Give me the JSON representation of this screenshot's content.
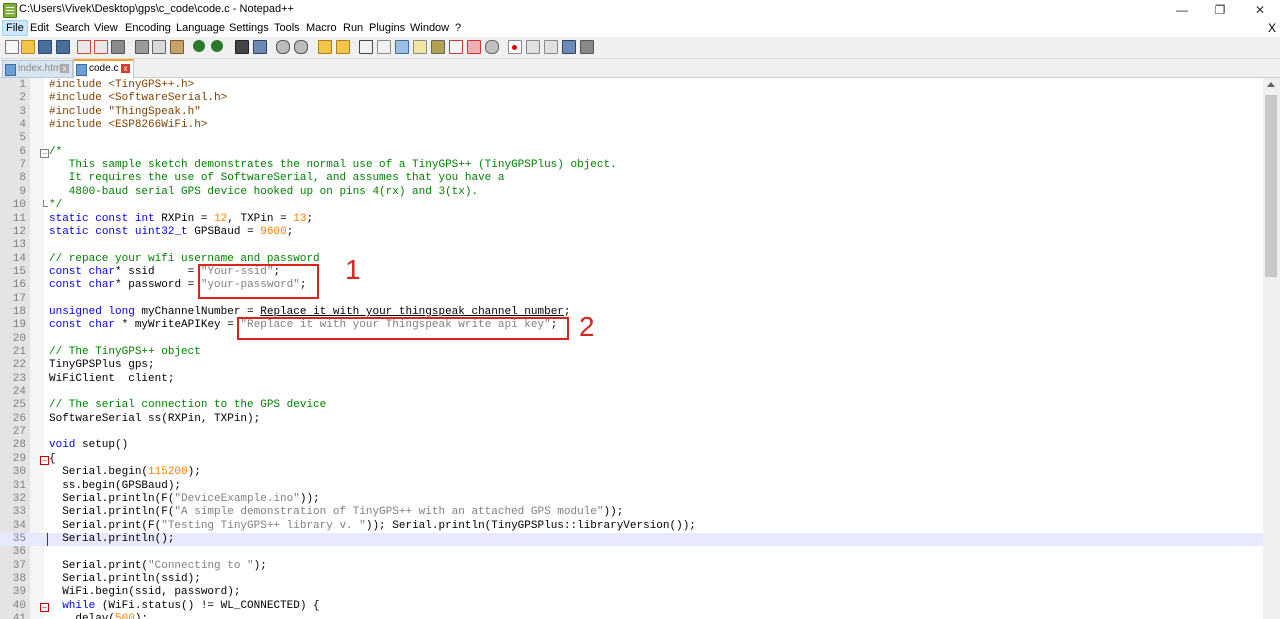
{
  "window": {
    "title": "C:\\Users\\Vivek\\Desktop\\gps\\c_code\\code.c - Notepad++",
    "minimize": "—",
    "maximize": "❐",
    "close": "✕"
  },
  "menu": {
    "items": [
      "File",
      "Edit",
      "Search",
      "View",
      "Encoding",
      "Language",
      "Settings",
      "Tools",
      "Macro",
      "Run",
      "Plugins",
      "Window",
      "?"
    ],
    "close_doc": "X"
  },
  "tabs": [
    {
      "label": "index.html",
      "close": "x"
    },
    {
      "label": "code.c",
      "close": "x"
    }
  ],
  "editor": {
    "current_line": 35,
    "lines": [
      {
        "n": "1",
        "code": "#include <TinyGPS++.h>"
      },
      {
        "n": "2",
        "code": "#include <SoftwareSerial.h>"
      },
      {
        "n": "3",
        "code": "#include \"ThingSpeak.h\""
      },
      {
        "n": "4",
        "code": "#include <ESP8266WiFi.h>"
      },
      {
        "n": "5",
        "code": ""
      },
      {
        "n": "6",
        "code": "/*"
      },
      {
        "n": "7",
        "code": "   This sample sketch demonstrates the normal use of a TinyGPS++ (TinyGPSPlus) object."
      },
      {
        "n": "8",
        "code": "   It requires the use of SoftwareSerial, and assumes that you have a"
      },
      {
        "n": "9",
        "code": "   4800-baud serial GPS device hooked up on pins 4(rx) and 3(tx)."
      },
      {
        "n": "10",
        "code": "*/"
      },
      {
        "n": "11",
        "code": "static const int RXPin = 12, TXPin = 13;"
      },
      {
        "n": "12",
        "code": "static const uint32_t GPSBaud = 9600;"
      },
      {
        "n": "13",
        "code": ""
      },
      {
        "n": "14",
        "code": "// repace your wifi username and password"
      },
      {
        "n": "15",
        "code": "const char* ssid     = \"Your-ssid\";"
      },
      {
        "n": "16",
        "code": "const char* password = \"your-password\";"
      },
      {
        "n": "17",
        "code": ""
      },
      {
        "n": "18",
        "code": "unsigned long myChannelNumber = Replace it with your thingspeak channel number;"
      },
      {
        "n": "19",
        "code": "const char * myWriteAPIKey = \"Replace it with your Thingspeak write api key\";"
      },
      {
        "n": "20",
        "code": ""
      },
      {
        "n": "21",
        "code": "// The TinyGPS++ object"
      },
      {
        "n": "22",
        "code": "TinyGPSPlus gps;"
      },
      {
        "n": "23",
        "code": "WiFiClient  client;"
      },
      {
        "n": "24",
        "code": ""
      },
      {
        "n": "25",
        "code": "// The serial connection to the GPS device"
      },
      {
        "n": "26",
        "code": "SoftwareSerial ss(RXPin, TXPin);"
      },
      {
        "n": "27",
        "code": ""
      },
      {
        "n": "28",
        "code": "void setup()"
      },
      {
        "n": "29",
        "code": "{"
      },
      {
        "n": "30",
        "code": "  Serial.begin(115200);"
      },
      {
        "n": "31",
        "code": "  ss.begin(GPSBaud);"
      },
      {
        "n": "32",
        "code": "  Serial.println(F(\"DeviceExample.ino\"));"
      },
      {
        "n": "33",
        "code": "  Serial.println(F(\"A simple demonstration of TinyGPS++ with an attached GPS module\"));"
      },
      {
        "n": "34",
        "code": "  Serial.print(F(\"Testing TinyGPS++ library v. \")); Serial.println(TinyGPSPlus::libraryVersion());"
      },
      {
        "n": "35",
        "code": "  Serial.println();"
      },
      {
        "n": "36",
        "code": ""
      },
      {
        "n": "37",
        "code": "  Serial.print(\"Connecting to \");"
      },
      {
        "n": "38",
        "code": "  Serial.println(ssid);"
      },
      {
        "n": "39",
        "code": "  WiFi.begin(ssid, password);"
      },
      {
        "n": "40",
        "code": "  while (WiFi.status() != WL_CONNECTED) {"
      },
      {
        "n": "41",
        "code": "    delay(500);"
      }
    ]
  },
  "annotations": {
    "label_1": "1",
    "label_2": "2"
  },
  "colors": {
    "keyword": "#0000ff",
    "type": "#8000ff",
    "number": "#ff8000",
    "string": "#808080",
    "comment": "#008000",
    "highlight_box": "#d9261c",
    "active_tab_accent": "#f3a12d"
  }
}
